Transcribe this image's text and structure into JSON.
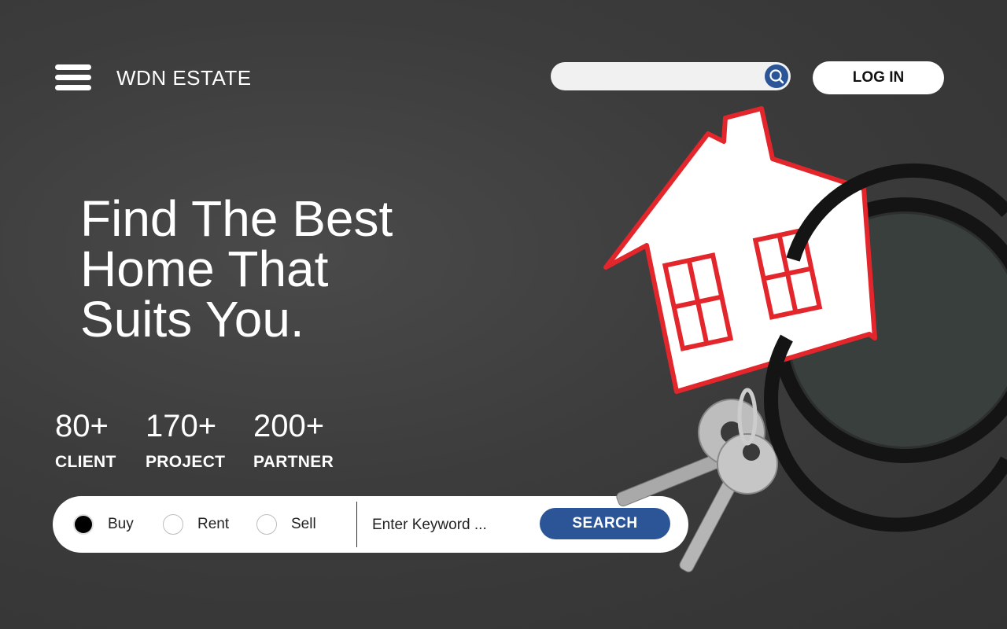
{
  "header": {
    "brand": "WDN ESTATE",
    "search_placeholder": "",
    "login_label": "LOG IN"
  },
  "hero": {
    "lines": [
      "Find The Best",
      "Home That",
      "Suits You."
    ]
  },
  "stats": [
    {
      "value": "80+",
      "label": "CLIENT"
    },
    {
      "value": "170+",
      "label": "PROJECT"
    },
    {
      "value": "200+",
      "label": "PARTNER"
    }
  ],
  "search_bar": {
    "options": [
      {
        "label": "Buy",
        "checked": true
      },
      {
        "label": "Rent",
        "checked": false
      },
      {
        "label": "Sell",
        "checked": false
      }
    ],
    "keyword_placeholder": "Enter Keyword ...",
    "submit_label": "SEARCH"
  },
  "colors": {
    "accent": "#2b5597",
    "background": "#3a3a3a",
    "house_outline": "#e3262b"
  },
  "icons": {
    "menu": "hamburger-icon",
    "search": "magnifier-icon"
  }
}
